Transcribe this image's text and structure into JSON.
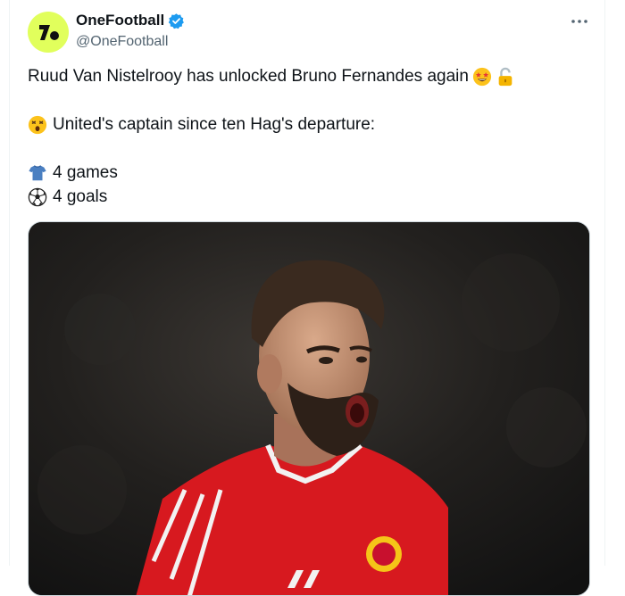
{
  "account": {
    "display_name": "OneFootball",
    "handle": "@OneFootball",
    "verified": true,
    "avatar_color": "#e1ff5c",
    "verified_color": "#1d9bf0"
  },
  "tweet": {
    "line1": "Ruud Van Nistelrooy has unlocked Bruno Fernandes again",
    "line2": "United's captain since ten Hag's departure:",
    "stat_games": "4 games",
    "stat_goals": "4 goals"
  },
  "icons": {
    "line1_emojis": [
      "star-struck-icon",
      "unlocked-padlock-icon"
    ],
    "line2_emoji": "astonished-face-icon",
    "games_emoji": "shirt-icon",
    "goals_emoji": "soccer-ball-icon",
    "menu": "more-options-icon"
  },
  "media": {
    "kit_color": "#d7191f",
    "background_color": "#1a1a1a"
  }
}
